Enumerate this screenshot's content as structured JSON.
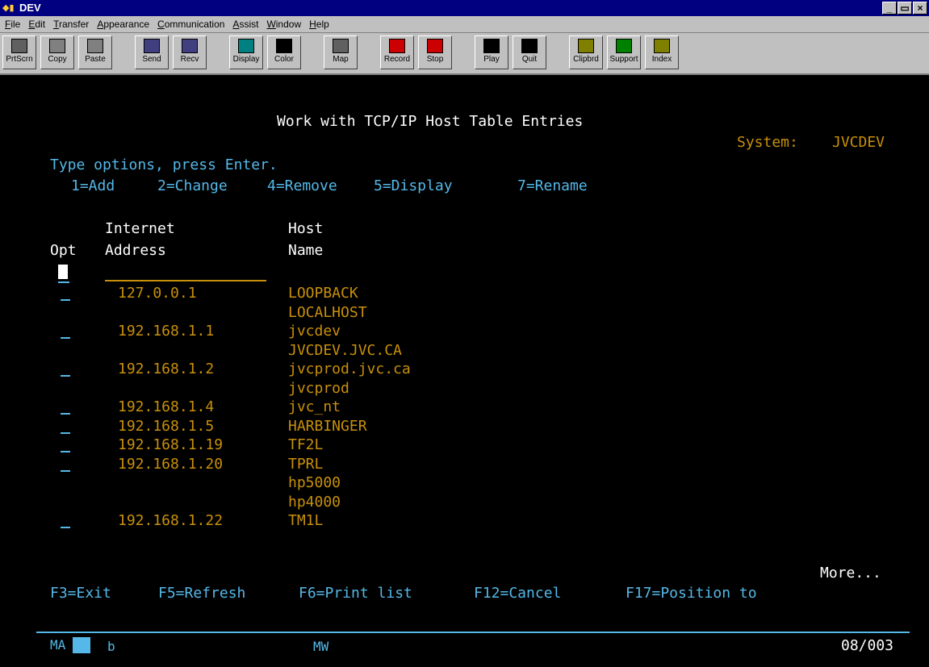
{
  "window": {
    "title": "DEV",
    "min": "_",
    "max": "▭",
    "close": "×"
  },
  "menu": [
    "File",
    "Edit",
    "Transfer",
    "Appearance",
    "Communication",
    "Assist",
    "Window",
    "Help"
  ],
  "toolbar": [
    {
      "label": "PrtScrn",
      "icon": "print-screen-icon",
      "color": "#606060"
    },
    {
      "label": "Copy",
      "icon": "copy-icon",
      "color": "#808080"
    },
    {
      "label": "Paste",
      "icon": "paste-icon",
      "color": "#808080"
    },
    {
      "label": "Send",
      "icon": "send-icon",
      "color": "#404080"
    },
    {
      "label": "Recv",
      "icon": "receive-icon",
      "color": "#404080"
    },
    {
      "label": "Display",
      "icon": "display-icon",
      "color": "#008080"
    },
    {
      "label": "Color",
      "icon": "color-icon",
      "color": "#000000"
    },
    {
      "label": "Map",
      "icon": "map-icon",
      "color": "#606060"
    },
    {
      "label": "Record",
      "icon": "record-icon",
      "color": "#cc0000"
    },
    {
      "label": "Stop",
      "icon": "stop-icon",
      "color": "#cc0000"
    },
    {
      "label": "Play",
      "icon": "play-icon",
      "color": "#000000"
    },
    {
      "label": "Quit",
      "icon": "quit-icon",
      "color": "#000000"
    },
    {
      "label": "Clipbrd",
      "icon": "clipboard-icon",
      "color": "#808000"
    },
    {
      "label": "Support",
      "icon": "support-icon",
      "color": "#008000"
    },
    {
      "label": "Index",
      "icon": "index-icon",
      "color": "#808000"
    }
  ],
  "screen": {
    "title": "Work with TCP/IP Host Table Entries",
    "system_label": "System:",
    "system_value": "JVCDEV",
    "instructions": "Type options, press Enter.",
    "options": [
      "1=Add",
      "2=Change",
      "4=Remove",
      "5=Display",
      "7=Rename"
    ],
    "col_internet_1": "Internet",
    "col_internet_2": "Address",
    "col_host_1": "Host",
    "col_host_2": "Name",
    "col_opt": "Opt",
    "entries": [
      {
        "address": "127.0.0.1",
        "names": [
          "LOOPBACK",
          "LOCALHOST"
        ]
      },
      {
        "address": "192.168.1.1",
        "names": [
          "jvcdev",
          "JVCDEV.JVC.CA"
        ]
      },
      {
        "address": "192.168.1.2",
        "names": [
          "jvcprod.jvc.ca",
          "jvcprod"
        ]
      },
      {
        "address": "192.168.1.4",
        "names": [
          "jvc_nt"
        ]
      },
      {
        "address": "192.168.1.5",
        "names": [
          "HARBINGER"
        ]
      },
      {
        "address": "192.168.1.19",
        "names": [
          "TF2L"
        ]
      },
      {
        "address": "192.168.1.20",
        "names": [
          "TPRL",
          "hp5000",
          "hp4000"
        ]
      },
      {
        "address": "192.168.1.22",
        "names": [
          "TM1L"
        ]
      }
    ],
    "more": "More...",
    "fkeys": [
      "F3=Exit",
      "F5=Refresh",
      "F6=Print list",
      "F12=Cancel",
      "F17=Position to"
    ],
    "oia": {
      "left": "MA",
      "b": "b",
      "mw": "MW",
      "pos": "08/003"
    }
  }
}
